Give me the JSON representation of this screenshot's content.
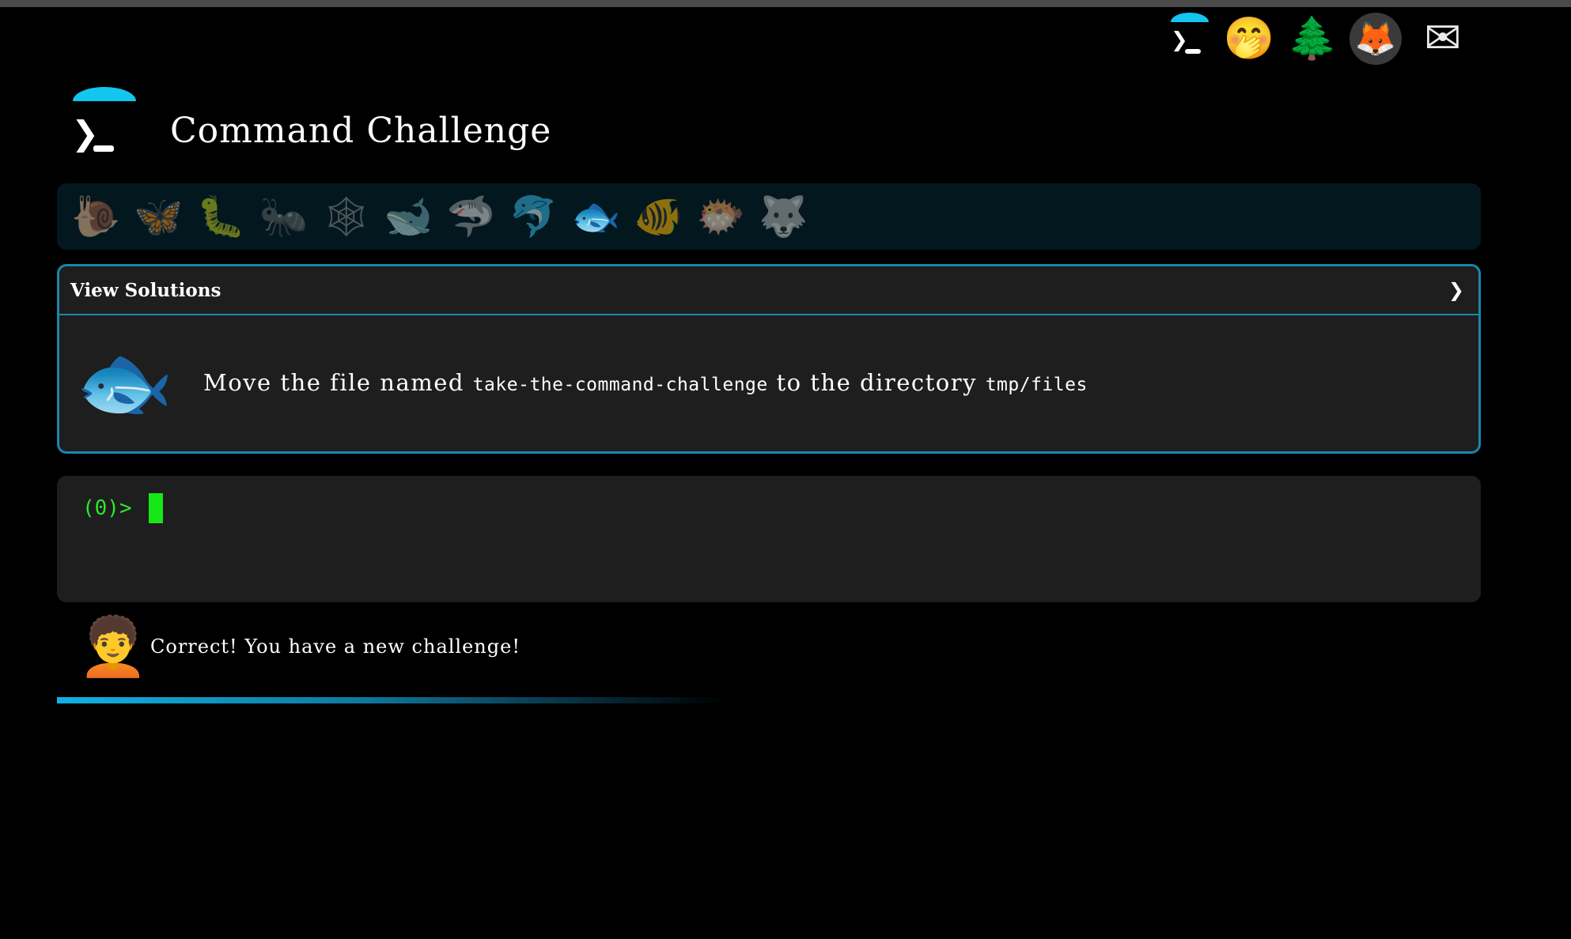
{
  "app": {
    "title": "Command Challenge"
  },
  "topnav": {
    "items": [
      {
        "icon": "terminal-logo-icon",
        "glyph_chevron": "❯"
      },
      {
        "icon": "face-with-hand-over-mouth-icon",
        "glyph": "🤭"
      },
      {
        "icon": "evergreen-tree-icon",
        "glyph": "🌲"
      },
      {
        "icon": "gitlab-fox-icon",
        "glyph": "🦊"
      },
      {
        "icon": "envelope-icon",
        "glyph": "✉"
      }
    ]
  },
  "logo": {
    "icon": "terminal-logo-icon",
    "chevron": "❯"
  },
  "creatures": [
    {
      "name": "snail",
      "glyph": "🐌"
    },
    {
      "name": "butterfly",
      "glyph": "🦋"
    },
    {
      "name": "caterpillar",
      "glyph": "🐛"
    },
    {
      "name": "ant",
      "glyph": "🐜"
    },
    {
      "name": "spider-web",
      "glyph": "🕸"
    },
    {
      "name": "whale",
      "glyph": "🐋"
    },
    {
      "name": "shark",
      "glyph": "🦈"
    },
    {
      "name": "dolphin",
      "glyph": "🐬"
    },
    {
      "name": "fish",
      "glyph": "🐟"
    },
    {
      "name": "tropical-fish",
      "glyph": "🐠"
    },
    {
      "name": "blowfish",
      "glyph": "🐡"
    },
    {
      "name": "wolf",
      "glyph": "🐺"
    }
  ],
  "panel": {
    "header_label": "View Solutions",
    "chevron": "❯",
    "fish_glyph": "🐟",
    "task": {
      "part1": "Move the file named ",
      "filename": "take-the-command-challenge",
      "part2": " to the directory ",
      "directory": "tmp/files"
    }
  },
  "terminal": {
    "prompt": "(0)>"
  },
  "status": {
    "avatar_glyph": "🧑‍🦱",
    "message": "Correct! You have a new challenge!"
  },
  "progress": {
    "fraction": 0.47
  },
  "colors": {
    "accent": "#12c6ef",
    "panel_border": "#1a86ad",
    "prompt_green": "#2ee62e",
    "strip_bg": "#03171e",
    "panel_bg": "#1e1e1e"
  }
}
